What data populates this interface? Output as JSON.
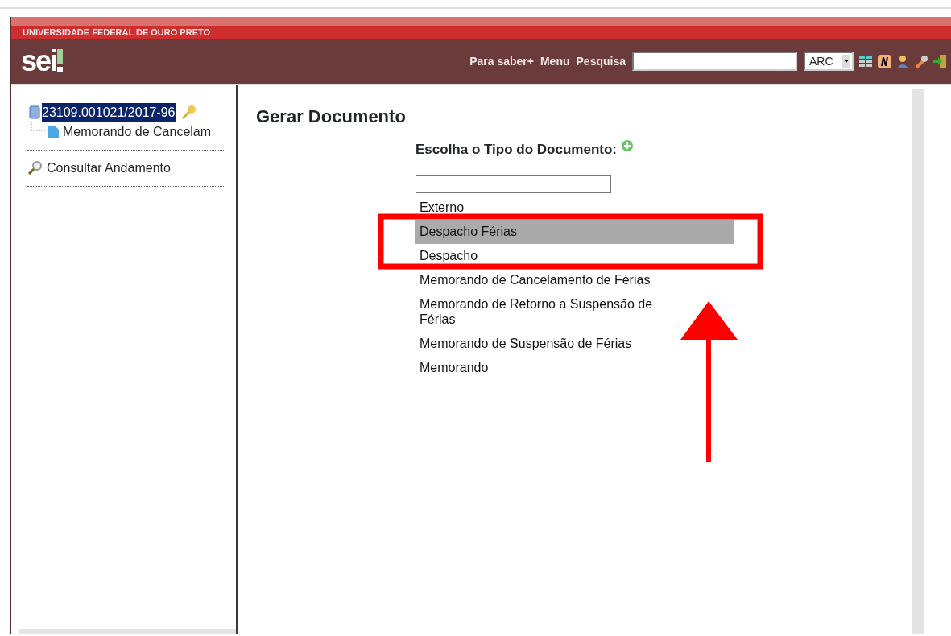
{
  "header": {
    "organization": "UNIVERSIDADE FEDERAL DE OURO PRETO",
    "logo": "sei",
    "nav_links": [
      "Para saber+",
      "Menu",
      "Pesquisa"
    ],
    "unit_select": {
      "value": "ARC"
    }
  },
  "sidebar": {
    "tree": [
      {
        "label": "23109.001021/2017-96",
        "selected": true,
        "children": [
          {
            "label": "Memorando de Cancelam",
            "selected": false
          }
        ]
      }
    ],
    "actions": [
      {
        "label": "Consultar Andamento"
      }
    ]
  },
  "main": {
    "title": "Gerar Documento",
    "subtitle": "Escolha o Tipo do Documento:",
    "document_types": [
      {
        "label": "Externo",
        "selected": false
      },
      {
        "label": "Despacho Férias",
        "selected": true
      },
      {
        "label": "Despacho",
        "selected": false
      },
      {
        "label": "Memorando de Cancelamento de Férias",
        "selected": false
      },
      {
        "label": "Memorando de Retorno a Suspensão de Férias",
        "selected": false
      },
      {
        "label": "Memorando de Suspensão de Férias",
        "selected": false
      },
      {
        "label": "Memorando",
        "selected": false
      }
    ]
  }
}
